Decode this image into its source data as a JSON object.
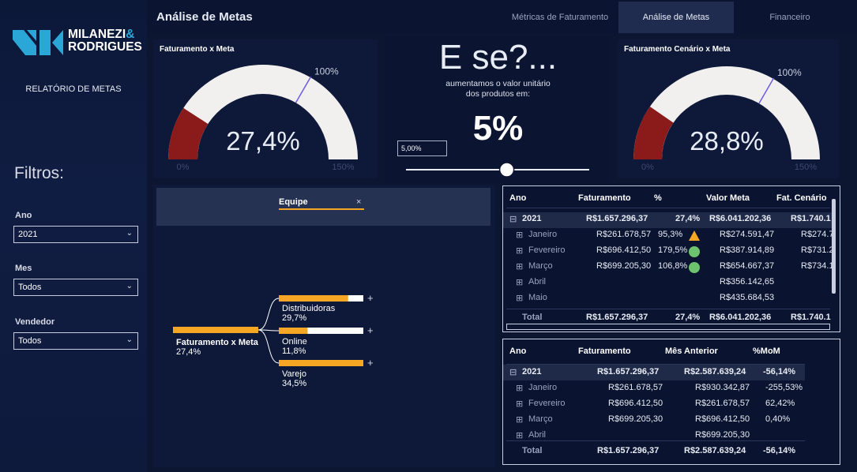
{
  "brand": {
    "line1": "MILANEZI",
    "amp": "&",
    "line2": "RODRIGUES"
  },
  "sidebar": {
    "report_label": "RELATÓRIO DE METAS",
    "filters_title": "Filtros:",
    "filters": [
      {
        "label": "Ano",
        "value": "2021"
      },
      {
        "label": "Mes",
        "value": "Todos"
      },
      {
        "label": "Vendedor",
        "value": "Todos"
      }
    ]
  },
  "header": {
    "title": "Análise de Metas",
    "tabs": [
      "Métricas de Faturamento",
      "Análise de Metas",
      "Financeiro"
    ],
    "active_tab": 1
  },
  "gauge1": {
    "title": "Faturamento x Meta",
    "value_text": "27,4%",
    "value": 27.4,
    "max": 150,
    "target": 100,
    "min_label": "0%",
    "max_label": "150%",
    "target_label": "100%"
  },
  "gauge2": {
    "title": "Faturamento Cenário x Meta",
    "value_text": "28,8%",
    "value": 28.8,
    "max": 150,
    "target": 100,
    "min_label": "0%",
    "max_label": "150%",
    "target_label": "100%"
  },
  "whatif": {
    "headline": "E se?...",
    "line1": "aumentamos o valor unitário",
    "line2": "dos produtos em:",
    "value": "5%",
    "input_value": "5,00%",
    "slider_fraction": 0.55
  },
  "decomp": {
    "header_label": "Equipe",
    "close_icon": "×",
    "root": {
      "label": "Faturamento x Meta",
      "value": "27,4%"
    },
    "children": [
      {
        "label": "Distribuidoras",
        "value": "29,7%",
        "fill": 0.82
      },
      {
        "label": "Online",
        "value": "11,8%",
        "fill": 0.34
      },
      {
        "label": "Varejo",
        "value": "34,5%",
        "fill": 1.0
      }
    ]
  },
  "table1": {
    "headers": [
      "Ano",
      "Faturamento",
      "%",
      "Valor Meta",
      "Fat. Cenário"
    ],
    "year_row": [
      "2021",
      "R$1.657.296,37",
      "27,4%",
      "R$6.041.202,36",
      "R$1.740.1"
    ],
    "rows": [
      [
        "Janeiro",
        "R$261.678,57",
        "95,3%",
        "R$274.591,47",
        "R$274.7",
        "warn"
      ],
      [
        "Fevereiro",
        "R$696.412,50",
        "179,5%",
        "R$387.914,89",
        "R$731.2",
        "ok"
      ],
      [
        "Março",
        "R$699.205,30",
        "106,8%",
        "R$654.667,37",
        "R$734.1",
        "ok"
      ],
      [
        "Abril",
        "",
        "",
        "R$356.142,65",
        "",
        ""
      ],
      [
        "Maio",
        "",
        "",
        "R$435.684,53",
        "",
        ""
      ]
    ],
    "total_row": [
      "Total",
      "R$1.657.296,37",
      "27,4%",
      "R$6.041.202,36",
      "R$1.740.1"
    ]
  },
  "table2": {
    "headers": [
      "Ano",
      "Faturamento",
      "Mês Anterior",
      "%MoM"
    ],
    "year_row": [
      "2021",
      "R$1.657.296,37",
      "R$2.587.639,24",
      "-56,14%"
    ],
    "rows": [
      [
        "Janeiro",
        "R$261.678,57",
        "R$930.342,87",
        "-255,53%"
      ],
      [
        "Fevereiro",
        "R$696.412,50",
        "R$261.678,57",
        "62,42%"
      ],
      [
        "Março",
        "R$699.205,30",
        "R$696.412,50",
        "0,40%"
      ],
      [
        "Abril",
        "",
        "R$699.205,30",
        ""
      ]
    ],
    "total_row": [
      "Total",
      "R$1.657.296,37",
      "R$2.587.639,24",
      "-56,14%"
    ]
  },
  "colors": {
    "bg": "#0d1631",
    "gauge_fill": "#8b1a1a",
    "gauge_track": "#f2f0ef",
    "target_line": "#6b5be0",
    "bar": "#f5a623",
    "warn": "#f5a623",
    "ok": "#6ec46e"
  }
}
